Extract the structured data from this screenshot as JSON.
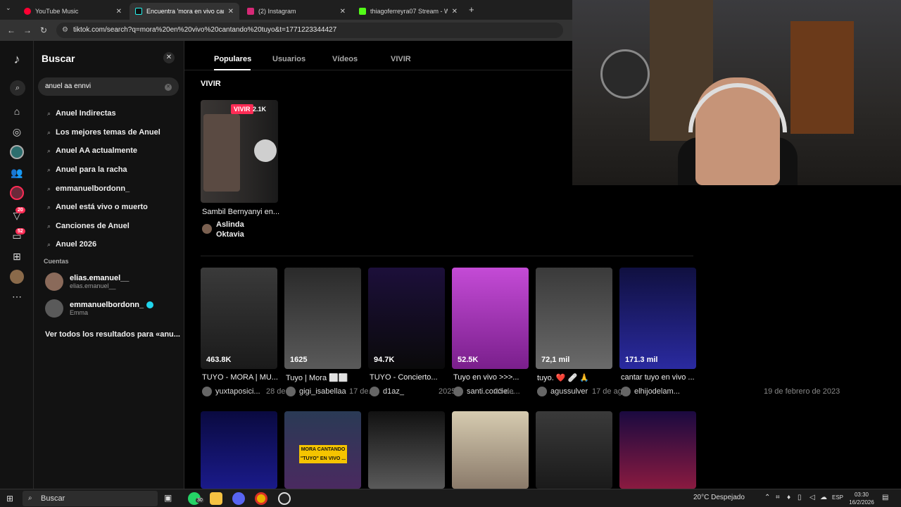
{
  "browser": {
    "tabs": [
      {
        "title": "YouTube Music",
        "color": "#ff0033"
      },
      {
        "title": "Encuentra 'mora en vivo cantan",
        "color": "#111111"
      },
      {
        "title": "(2) Instagram",
        "color": "#d62976"
      },
      {
        "title": "thiagoferreyra07 Stream - Wat",
        "color": "#53fc18"
      }
    ],
    "new_tab": "+",
    "url": "tiktok.com/search?q=mora%20en%20vivo%20cantando%20tuyo&t=1771223344427"
  },
  "search_panel": {
    "title": "Buscar",
    "query": "anuel aa ennvi",
    "suggestions": [
      "Anuel Indirectas",
      "Los mejores temas de Anuel",
      "Anuel AA actualmente",
      "Anuel para la racha",
      "emmanuelbordonn_",
      "Anuel está vivo o muerto",
      "Canciones de Anuel",
      "Anuel 2026"
    ],
    "accounts_label": "Cuentas",
    "accounts": [
      {
        "name": "elias.emanuel__",
        "sub": "elias.emanuel__"
      },
      {
        "name": "emmanuelbordonn_",
        "sub": "Emma",
        "verified": true
      }
    ],
    "see_all": "Ver todos los resultados para «anu..."
  },
  "rail": {
    "badges": [
      "20",
      "52"
    ]
  },
  "content_tabs": [
    "Populares",
    "Usuarios",
    "Vídeos",
    "VIVIR"
  ],
  "live": {
    "heading": "VIVIR",
    "badge": "VIVIR",
    "likes": "2.1K",
    "title": "Sambil Bernyanyi en...",
    "author": "Aslinda Oktavia"
  },
  "videos": [
    {
      "likes": "463.8K",
      "title": "TUYO - MORA | MU...",
      "author": "yuxtaposici...",
      "date": "28 de...",
      "colors": [
        "#3a3a3a",
        "#1a1a1a"
      ]
    },
    {
      "likes": "1625",
      "title": "Tuyo | Mora ⬜⬜",
      "author": "gigi_isabellaa",
      "date": "17 de...",
      "colors": [
        "#2a2a2a",
        "#5a5a5a"
      ]
    },
    {
      "likes": "94.7K",
      "title": "TUYO - Concierto...",
      "author": "d1az_",
      "date": "2025",
      "colors": [
        "#1c0f3a",
        "#0a0a0a"
      ]
    },
    {
      "likes": "52.5K",
      "title": "Tuyo en vivo >>>...",
      "author": "santi.concie...",
      "date": "23 de...",
      "colors": [
        "#c44bd6",
        "#7a1f8c"
      ]
    },
    {
      "likes": "72,1 mil",
      "title": "tuyo. ❤️ 🩹 🙏",
      "author": "agussulver",
      "date": "17 de ag...",
      "colors": [
        "#3a3a3a",
        "#6a6a6a"
      ]
    },
    {
      "likes": "171.3 mil",
      "title": "cantar tuyo en vivo ...",
      "author": "elhijodelam...",
      "date": "19 de febrero de 2023",
      "colors": [
        "#101040",
        "#2a2aa0"
      ]
    }
  ],
  "row2": {
    "overlay_text": "MORA CANTANDO \"TUYO\" EN VIVO ...",
    "colors": [
      [
        "#0a0a40",
        "#1a1a8a"
      ],
      [
        "#2a3a55",
        "#4a2a60"
      ],
      [
        "#111111",
        "#5a5a5a"
      ],
      [
        "#d6cbb0",
        "#8a7a6a"
      ],
      [
        "#3a3a3a",
        "#1a1a1a"
      ],
      [
        "#1a0a40",
        "#8a1a40"
      ]
    ]
  },
  "taskbar": {
    "search": "Buscar",
    "whatsapp_badge": "30",
    "weather": "20°C  Despejado",
    "lang": "ESP",
    "time": "03:30",
    "date": "16/2/2026"
  }
}
